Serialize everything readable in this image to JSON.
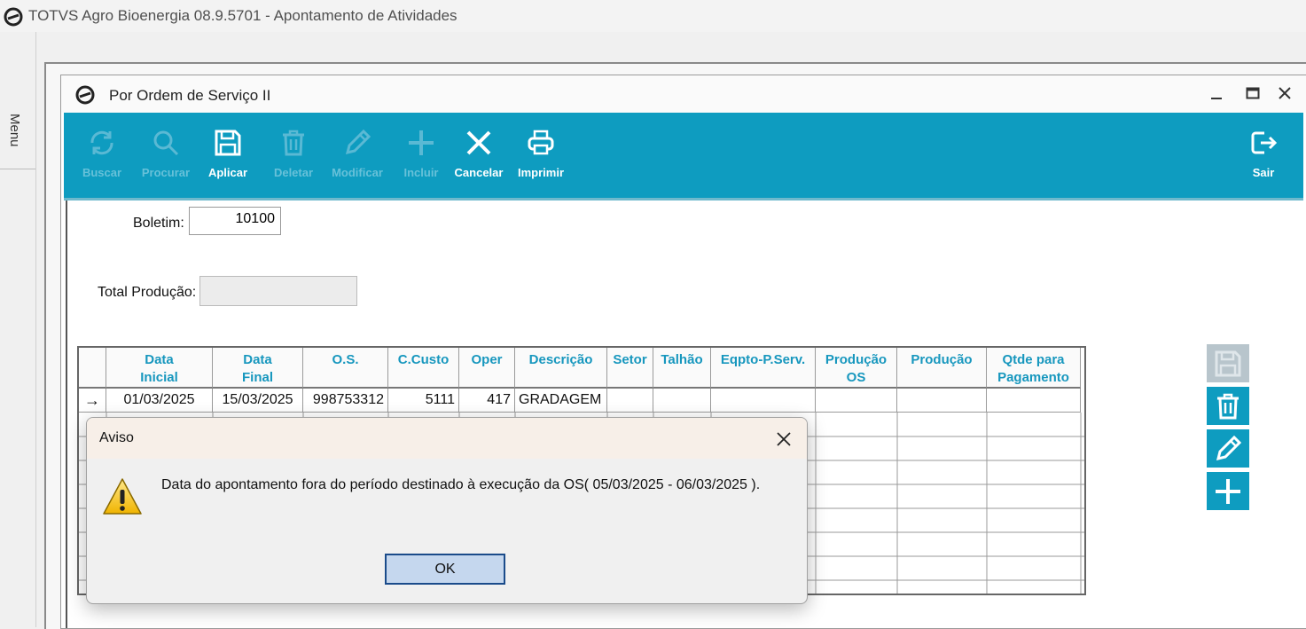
{
  "app": {
    "title": "TOTVS Agro Bioenergia 08.9.5701 - Apontamento de Atividades",
    "menu_label": "Menu"
  },
  "window": {
    "title": "Por Ordem de Serviço II",
    "controls": [
      "minimize-icon",
      "maximize-icon",
      "close-icon"
    ]
  },
  "toolbar": {
    "accent_color": "#0e9cc0",
    "buttons": [
      {
        "label": "Buscar",
        "icon": "refresh-icon",
        "enabled": false
      },
      {
        "label": "Procurar",
        "icon": "search-icon",
        "enabled": false
      },
      {
        "label": "Aplicar",
        "icon": "save-icon",
        "enabled": true
      },
      {
        "label": "Deletar",
        "icon": "trash-icon",
        "enabled": false
      },
      {
        "label": "Modificar",
        "icon": "pencil-icon",
        "enabled": false
      },
      {
        "label": "Incluir",
        "icon": "plus-icon",
        "enabled": false
      },
      {
        "label": "Cancelar",
        "icon": "x-icon",
        "enabled": true
      },
      {
        "label": "Imprimir",
        "icon": "printer-icon",
        "enabled": true
      }
    ],
    "exit_label": "Sair"
  },
  "form": {
    "boletim_label": "Boletim:",
    "boletim_value": "10100",
    "total_label": "Total Produção:",
    "total_value": ""
  },
  "grid": {
    "columns": [
      {
        "label": "Data\nInicial"
      },
      {
        "label": "Data\nFinal"
      },
      {
        "label": "O.S."
      },
      {
        "label": "C.Custo"
      },
      {
        "label": "Oper"
      },
      {
        "label": "Descrição"
      },
      {
        "label": "Setor"
      },
      {
        "label": "Talhão"
      },
      {
        "label": "Eqpto-P.Serv."
      },
      {
        "label": "Produção\nOS"
      },
      {
        "label": "Produção"
      },
      {
        "label": "Qtde para\nPagamento"
      }
    ],
    "rows": [
      [
        "01/03/2025",
        "15/03/2025",
        "998753312",
        "5111",
        "417",
        "GRADAGEM",
        "",
        "",
        "",
        "",
        "",
        ""
      ]
    ],
    "current_row_marker": "→"
  },
  "side_buttons": [
    "save-icon",
    "trash-icon",
    "pencil-icon",
    "plus-icon"
  ],
  "dialog": {
    "title": "Aviso",
    "message": "Data do apontamento fora do período destinado à execução da OS( 05/03/2025 - 06/03/2025 ).",
    "ok_label": "OK",
    "icon": "warning-icon"
  }
}
